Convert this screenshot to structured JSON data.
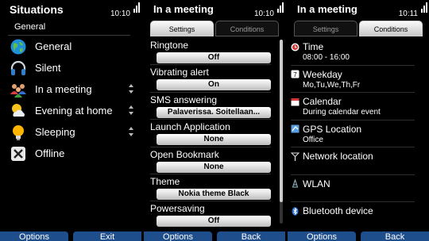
{
  "screens": {
    "situations": {
      "title": "Situations",
      "clock": "10:10",
      "network": "3G",
      "subtitle": "General",
      "items": [
        {
          "label": "General",
          "icon": "globe-icon"
        },
        {
          "label": "Silent",
          "icon": "headphones-icon"
        },
        {
          "label": "In a meeting",
          "icon": "people-icon",
          "reorder": true
        },
        {
          "label": "Evening at home",
          "icon": "sun-cloud-icon",
          "reorder": true
        },
        {
          "label": "Sleeping",
          "icon": "lightbulb-icon",
          "reorder": true
        },
        {
          "label": "Offline",
          "icon": "offline-icon"
        }
      ],
      "softkey_left": "Options",
      "softkey_right": "Exit"
    },
    "meeting_settings": {
      "title": "In a meeting",
      "clock": "10:10",
      "network": "3G",
      "tabs": [
        "Settings",
        "Conditions"
      ],
      "active_tab": 0,
      "settings": [
        {
          "label": "Ringtone",
          "value": "Off"
        },
        {
          "label": "Vibrating alert",
          "value": "On"
        },
        {
          "label": "SMS answering",
          "value": "Palaverissa. Soitellaan..."
        },
        {
          "label": "Launch Application",
          "value": "None"
        },
        {
          "label": "Open Bookmark",
          "value": "None"
        },
        {
          "label": "Theme",
          "value": "Nokia theme Black"
        },
        {
          "label": "Powersaving",
          "value": "Off"
        }
      ],
      "softkey_left": "Options",
      "softkey_right": "Back"
    },
    "meeting_conditions": {
      "title": "In a meeting",
      "clock": "10:11",
      "network": "3G",
      "tabs": [
        "Settings",
        "Conditions"
      ],
      "active_tab": 1,
      "conditions": [
        {
          "label": "Time",
          "value": "08:00 - 16:00",
          "icon": "clock-icon"
        },
        {
          "label": "Weekday",
          "value": "Mo,Tu,We,Th,Fr",
          "icon": "calendar-day-icon"
        },
        {
          "label": "Calendar",
          "value": "During calendar event",
          "icon": "calendar-icon"
        },
        {
          "label": "GPS Location",
          "value": "Office",
          "icon": "gps-icon"
        },
        {
          "label": "Network location",
          "value": "",
          "icon": "antenna-icon"
        },
        {
          "label": "WLAN",
          "value": "",
          "icon": "wlan-icon"
        },
        {
          "label": "Bluetooth device",
          "value": "",
          "icon": "bluetooth-icon"
        }
      ],
      "softkey_left": "Options",
      "softkey_right": "Back"
    }
  }
}
